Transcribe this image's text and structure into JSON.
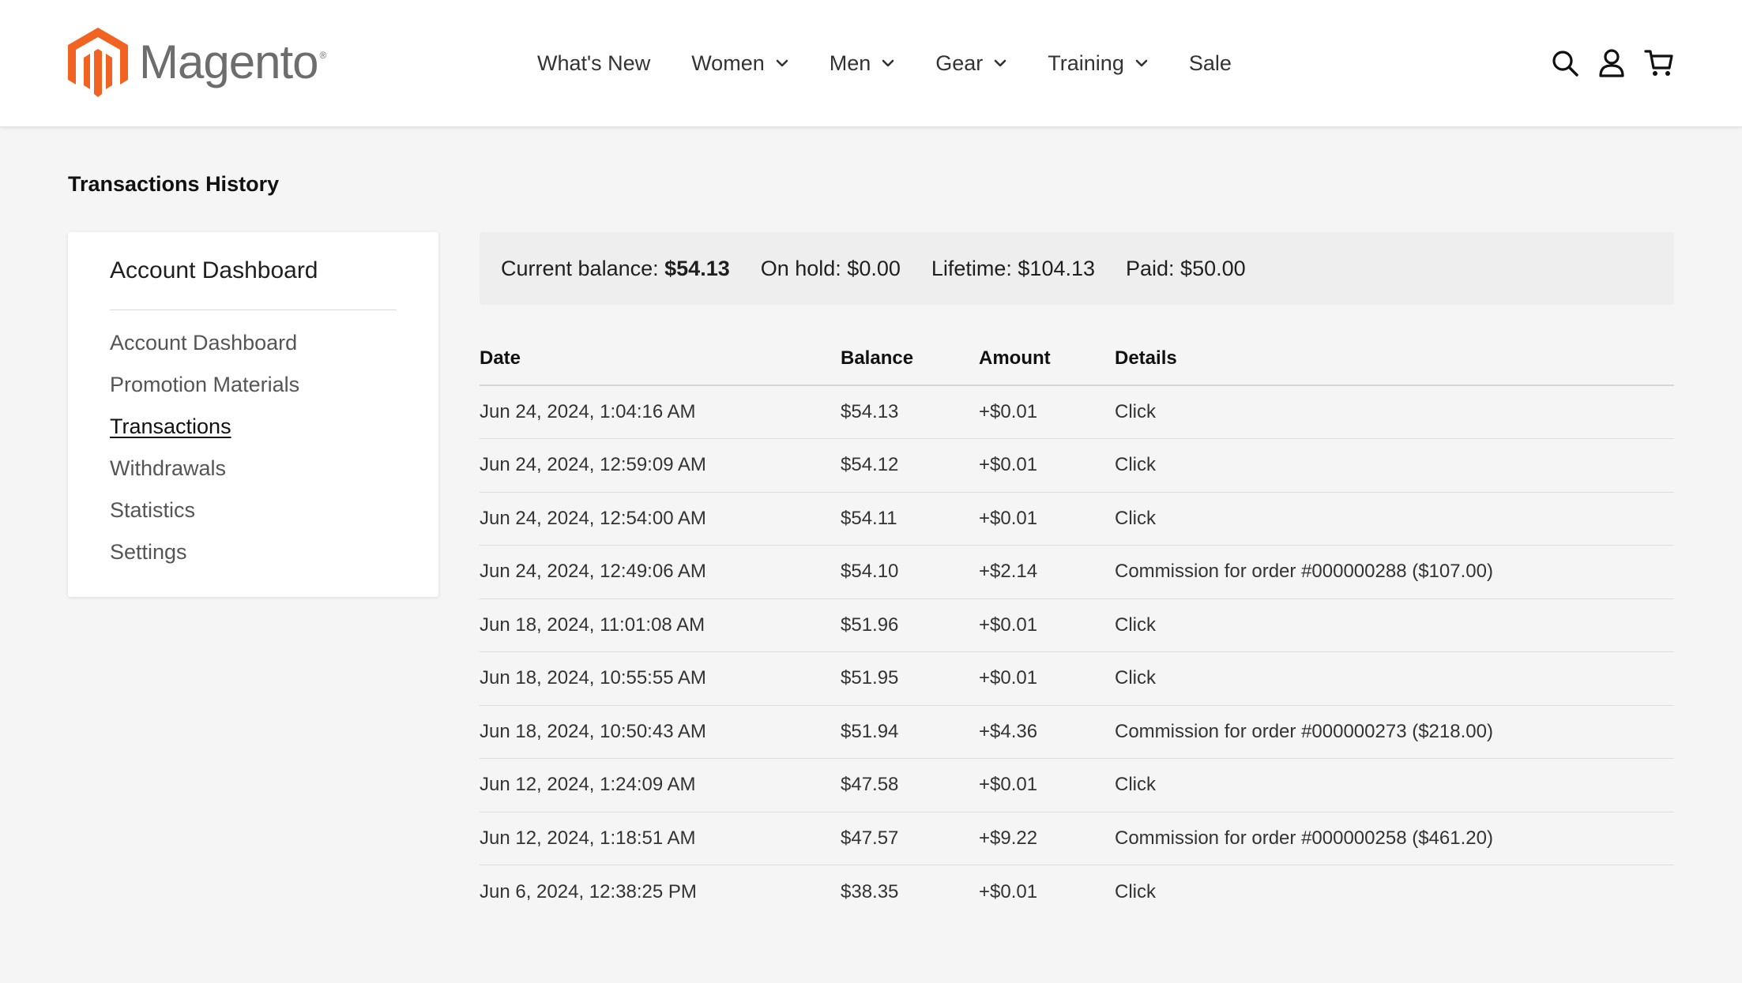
{
  "brand": {
    "name": "Magento",
    "reg": "®",
    "accent": "#f26322"
  },
  "nav": {
    "items": [
      {
        "label": "What's New",
        "dropdown": false
      },
      {
        "label": "Women",
        "dropdown": true
      },
      {
        "label": "Men",
        "dropdown": true
      },
      {
        "label": "Gear",
        "dropdown": true
      },
      {
        "label": "Training",
        "dropdown": true
      },
      {
        "label": "Sale",
        "dropdown": false
      }
    ]
  },
  "header_icons": [
    "search-icon",
    "account-icon",
    "cart-icon"
  ],
  "page": {
    "title": "Transactions History"
  },
  "sidebar": {
    "title": "Account Dashboard",
    "items": [
      {
        "label": "Account Dashboard",
        "active": false
      },
      {
        "label": "Promotion Materials",
        "active": false
      },
      {
        "label": "Transactions",
        "active": true
      },
      {
        "label": "Withdrawals",
        "active": false
      },
      {
        "label": "Statistics",
        "active": false
      },
      {
        "label": "Settings",
        "active": false
      }
    ]
  },
  "balance": {
    "current_label": "Current balance:",
    "current_value": "$54.13",
    "on_hold": "On hold: $0.00",
    "lifetime": "Lifetime: $104.13",
    "paid": "Paid: $50.00"
  },
  "table": {
    "headers": {
      "date": "Date",
      "balance": "Balance",
      "amount": "Amount",
      "details": "Details"
    },
    "rows": [
      {
        "date": "Jun 24, 2024, 1:04:16 AM",
        "balance": "$54.13",
        "amount": "+$0.01",
        "details": "Click"
      },
      {
        "date": "Jun 24, 2024, 12:59:09 AM",
        "balance": "$54.12",
        "amount": "+$0.01",
        "details": "Click"
      },
      {
        "date": "Jun 24, 2024, 12:54:00 AM",
        "balance": "$54.11",
        "amount": "+$0.01",
        "details": "Click"
      },
      {
        "date": "Jun 24, 2024, 12:49:06 AM",
        "balance": "$54.10",
        "amount": "+$2.14",
        "details": "Commission for order #000000288 ($107.00)"
      },
      {
        "date": "Jun 18, 2024, 11:01:08 AM",
        "balance": "$51.96",
        "amount": "+$0.01",
        "details": "Click"
      },
      {
        "date": "Jun 18, 2024, 10:55:55 AM",
        "balance": "$51.95",
        "amount": "+$0.01",
        "details": "Click"
      },
      {
        "date": "Jun 18, 2024, 10:50:43 AM",
        "balance": "$51.94",
        "amount": "+$4.36",
        "details": "Commission for order #000000273 ($218.00)"
      },
      {
        "date": "Jun 12, 2024, 1:24:09 AM",
        "balance": "$47.58",
        "amount": "+$0.01",
        "details": "Click"
      },
      {
        "date": "Jun 12, 2024, 1:18:51 AM",
        "balance": "$47.57",
        "amount": "+$9.22",
        "details": "Commission for order #000000258 ($461.20)"
      },
      {
        "date": "Jun 6, 2024, 12:38:25 PM",
        "balance": "$38.35",
        "amount": "+$0.01",
        "details": "Click"
      }
    ]
  }
}
